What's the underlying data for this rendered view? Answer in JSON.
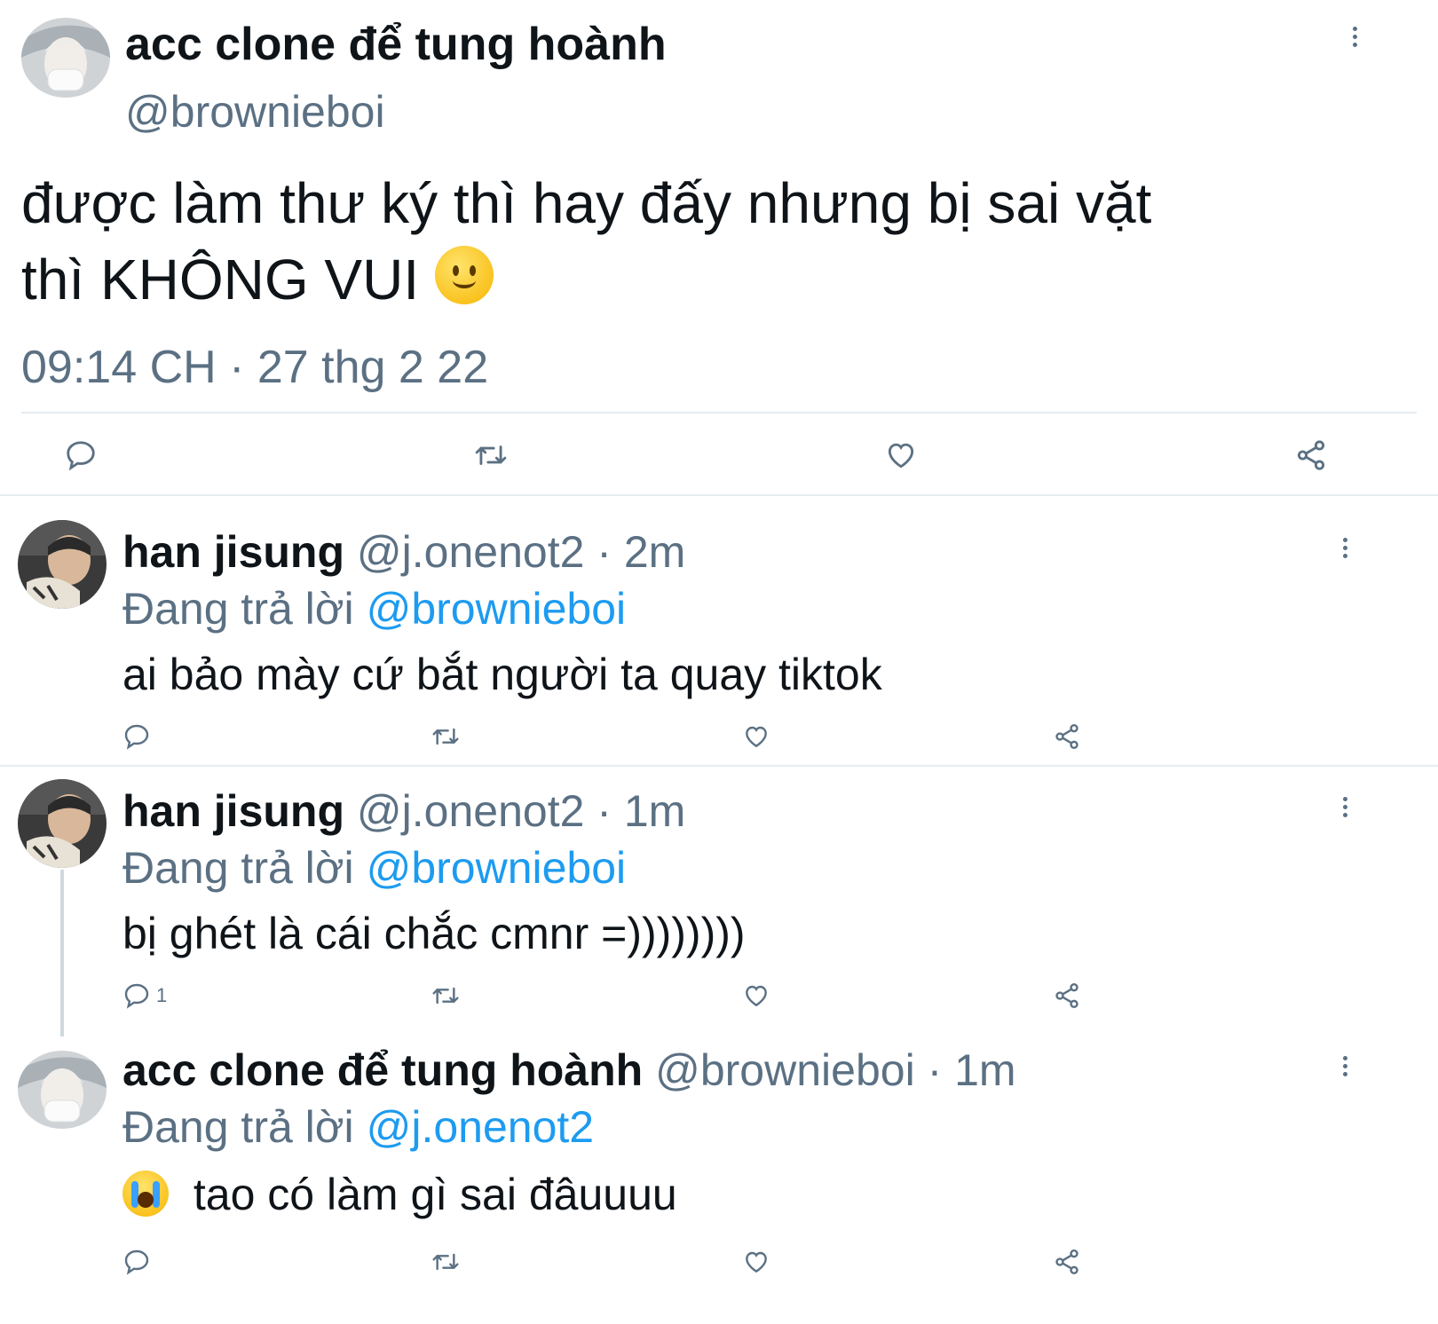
{
  "main_tweet": {
    "author_name": "acc clone để tung hoành",
    "handle": "@brownieboi",
    "text_line1": "được làm thư ký thì hay đấy nhưng bị sai vặt",
    "text_line2": "thì KHÔNG VUI",
    "emoji": "slightly-smiling-face",
    "timestamp": "09:14 CH · 27 thg 2 22"
  },
  "replies": [
    {
      "author_name": "han jisung",
      "meta": "@j.onenot2 · 2m",
      "replying_prefix": "Đang trả lời",
      "replying_to": "@brownieboi",
      "text": "ai bảo mày cứ bắt người ta quay tiktok",
      "reply_count": ""
    },
    {
      "author_name": "han jisung",
      "meta": "@j.onenot2 · 1m",
      "replying_prefix": "Đang trả lời",
      "replying_to": "@brownieboi",
      "text": "bị ghét là cái chắc cmnr =))))))))",
      "reply_count": "1"
    },
    {
      "author_name": "acc clone để tung hoành",
      "meta": "@brownieboi · 1m",
      "replying_prefix": "Đang trả lời",
      "replying_to": "@j.onenot2",
      "text": "tao có làm gì sai đâuuuu",
      "emoji": "loudly-crying-face",
      "reply_count": ""
    }
  ],
  "icons": [
    "reply-icon",
    "retweet-icon",
    "like-icon",
    "share-icon",
    "more-icon"
  ],
  "colors": {
    "text": "#0f1419",
    "secondary": "#5b7083",
    "link": "#1d9bf0",
    "divider": "#e6ecf0"
  }
}
